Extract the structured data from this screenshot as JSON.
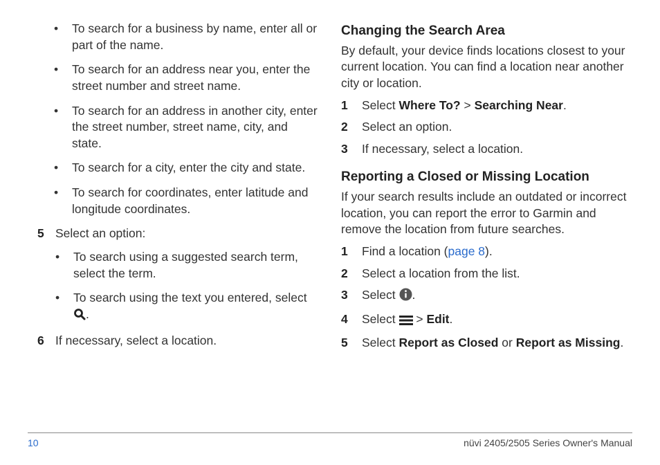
{
  "left": {
    "bullets1": [
      "To search for a business by name, enter all or part of the name.",
      "To search for an address near you, enter the street number and street name.",
      "To search for an address in another city, enter the street number, street name, city, and state.",
      "To search for a city, enter the city and state.",
      "To search for coordinates, enter latitude and longitude coordinates."
    ],
    "step5_num": "5",
    "step5_text": "Select an option:",
    "bullets2": [
      "To search using a suggested search term, select the term.",
      "To search using the text you entered, select "
    ],
    "step6_num": "6",
    "step6_text": "If necessary, select a location."
  },
  "right": {
    "h1": "Changing the Search Area",
    "p1": "By default, your device finds locations closest to your current location. You can find a location near another city or location.",
    "s1_num": "1",
    "s1_a": "Select ",
    "s1_b_strong": "Where To?",
    "s1_c": " > ",
    "s1_d_strong": "Searching Near",
    "s1_e": ".",
    "s2_num": "2",
    "s2": "Select an option.",
    "s3_num": "3",
    "s3": "If necessary, select a location.",
    "h2": "Reporting a Closed or Missing Location",
    "p2": "If your search results include an outdated or incorrect location, you can report the error to Garmin and remove the location from future searches.",
    "r1_num": "1",
    "r1_a": "Find a location (",
    "r1_link": "page 8",
    "r1_b": ").",
    "r2_num": "2",
    "r2": "Select a location from the list.",
    "r3_num": "3",
    "r3_a": "Select ",
    "r3_b": ".",
    "r4_num": "4",
    "r4_a": "Select ",
    "r4_b": " > ",
    "r4_c_strong": "Edit",
    "r4_d": ".",
    "r5_num": "5",
    "r5_a": "Select ",
    "r5_b_strong": "Report as Closed",
    "r5_c": " or ",
    "r5_d_strong": "Report as Missing",
    "r5_e": "."
  },
  "footer": {
    "page": "10",
    "title": "nüvi 2405/2505 Series Owner's Manual"
  }
}
